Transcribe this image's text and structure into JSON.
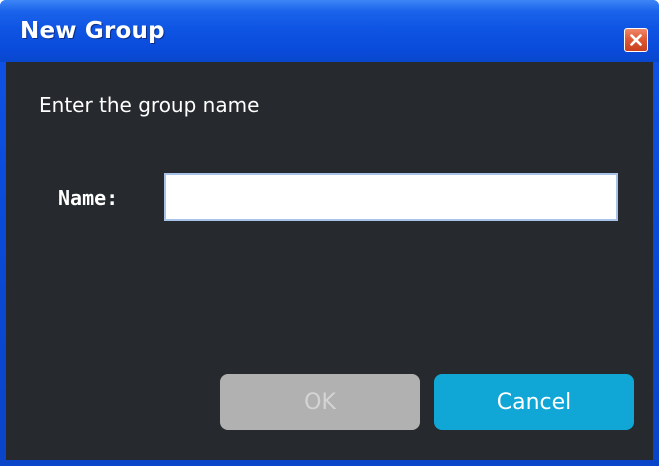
{
  "window": {
    "title": "New Group",
    "close_icon": "close-icon"
  },
  "dialog": {
    "prompt": "Enter the group name",
    "name_label": "Name:",
    "name_value": "",
    "ok_label": "OK",
    "ok_enabled": false,
    "cancel_label": "Cancel"
  },
  "colors": {
    "title_bar": "#0f55e4",
    "client_background": "#262a2e",
    "ok_disabled": "#b1b1b1",
    "cancel_accent": "#10a7d6",
    "close_button": "#e05a36"
  }
}
